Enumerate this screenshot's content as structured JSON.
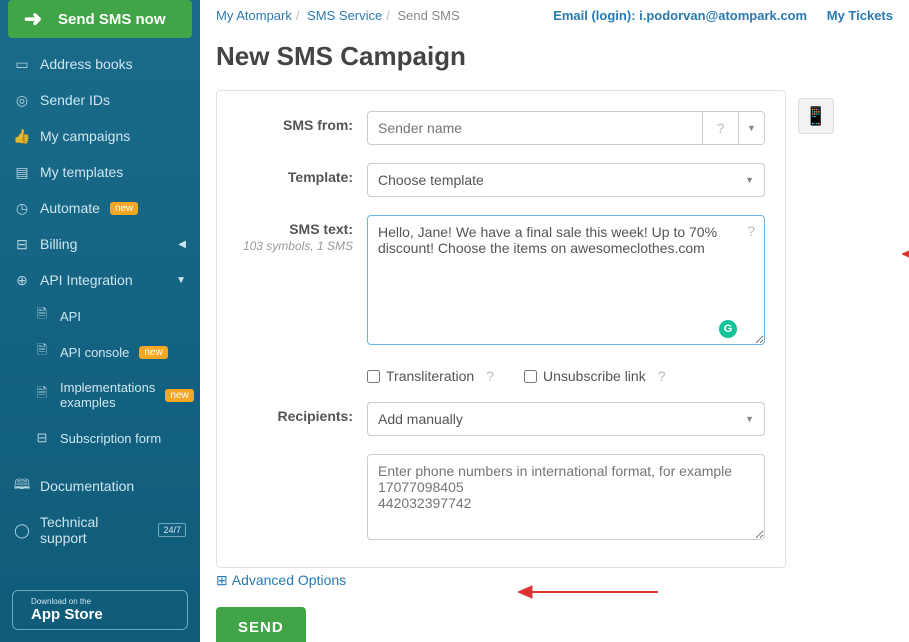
{
  "sidebar": {
    "send_now": "Send SMS now",
    "items": [
      {
        "icon": "book",
        "label": "Address books"
      },
      {
        "icon": "id",
        "label": "Sender IDs"
      },
      {
        "icon": "camp",
        "label": "My campaigns"
      },
      {
        "icon": "tmpl",
        "label": "My templates"
      },
      {
        "icon": "auto",
        "label": "Automate",
        "badge": "new"
      },
      {
        "icon": "bill",
        "label": "Billing",
        "caret": "left"
      },
      {
        "icon": "api",
        "label": "API Integration",
        "caret": "down"
      }
    ],
    "api_sub": [
      {
        "label": "API"
      },
      {
        "label": "API console",
        "badge": "new"
      },
      {
        "label": "Implementations examples",
        "badge": "new"
      },
      {
        "label": "Subscription form"
      }
    ],
    "footer_items": [
      {
        "icon": "doc",
        "label": "Documentation"
      },
      {
        "icon": "sup",
        "label": "Technical support",
        "badge247": "24/7"
      }
    ],
    "appstore_small": "Download on the",
    "appstore_big": "App Store"
  },
  "breadcrumb": [
    "My Atompark",
    "SMS Service",
    "Send SMS"
  ],
  "toplinks": {
    "email_label": "Email (login): i.podorvan@atompark.com",
    "tickets": "My Tickets"
  },
  "title": "New SMS Campaign",
  "form": {
    "from_label": "SMS from:",
    "from_placeholder": "Sender name",
    "template_label": "Template:",
    "template_value": "Choose template",
    "text_label": "SMS text:",
    "text_sub": "103 symbols, 1 SMS",
    "text_value": "Hello, Jane! We have a final sale this week! Up to 70% discount! Choose the items on awesomeclothes.com",
    "translit": "Transliteration",
    "unsub": "Unsubscribe link",
    "recip_label": "Recipients:",
    "recip_value": "Add manually",
    "phones_placeholder": "Enter phone numbers in international format, for example\n17077098405\n442032397742",
    "advanced": "Advanced Options",
    "send": "SEND"
  }
}
